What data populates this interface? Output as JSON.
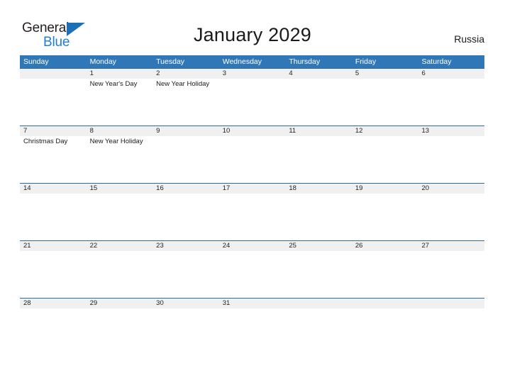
{
  "brand": {
    "name_part1": "General",
    "name_part2": "Blue",
    "triangle_icon": "triangle-icon",
    "colors": {
      "dark": "#231f20",
      "blue": "#1c7fd4",
      "triangle": "#1c6fb5"
    }
  },
  "header": {
    "title": "January 2029",
    "country": "Russia"
  },
  "theme": {
    "header_blue": "#3077b8",
    "rule_blue": "#2b6ca8",
    "date_band_gray": "#f0f0f0",
    "cell_white": "#ffffff",
    "text_dark": "#1a1a1a"
  },
  "calendar": {
    "month": "January",
    "year": "2029",
    "weekday_headers": [
      "Sunday",
      "Monday",
      "Tuesday",
      "Wednesday",
      "Thursday",
      "Friday",
      "Saturday"
    ],
    "weeks": [
      [
        {
          "date": "",
          "events": []
        },
        {
          "date": "1",
          "events": [
            "New Year's Day"
          ]
        },
        {
          "date": "2",
          "events": [
            "New Year Holiday"
          ]
        },
        {
          "date": "3",
          "events": []
        },
        {
          "date": "4",
          "events": []
        },
        {
          "date": "5",
          "events": []
        },
        {
          "date": "6",
          "events": []
        }
      ],
      [
        {
          "date": "7",
          "events": [
            "Christmas Day"
          ]
        },
        {
          "date": "8",
          "events": [
            "New Year Holiday"
          ]
        },
        {
          "date": "9",
          "events": []
        },
        {
          "date": "10",
          "events": []
        },
        {
          "date": "11",
          "events": []
        },
        {
          "date": "12",
          "events": []
        },
        {
          "date": "13",
          "events": []
        }
      ],
      [
        {
          "date": "14",
          "events": []
        },
        {
          "date": "15",
          "events": []
        },
        {
          "date": "16",
          "events": []
        },
        {
          "date": "17",
          "events": []
        },
        {
          "date": "18",
          "events": []
        },
        {
          "date": "19",
          "events": []
        },
        {
          "date": "20",
          "events": []
        }
      ],
      [
        {
          "date": "21",
          "events": []
        },
        {
          "date": "22",
          "events": []
        },
        {
          "date": "23",
          "events": []
        },
        {
          "date": "24",
          "events": []
        },
        {
          "date": "25",
          "events": []
        },
        {
          "date": "26",
          "events": []
        },
        {
          "date": "27",
          "events": []
        }
      ],
      [
        {
          "date": "28",
          "events": []
        },
        {
          "date": "29",
          "events": []
        },
        {
          "date": "30",
          "events": []
        },
        {
          "date": "31",
          "events": []
        },
        {
          "date": "",
          "events": []
        },
        {
          "date": "",
          "events": []
        },
        {
          "date": "",
          "events": []
        }
      ]
    ]
  }
}
